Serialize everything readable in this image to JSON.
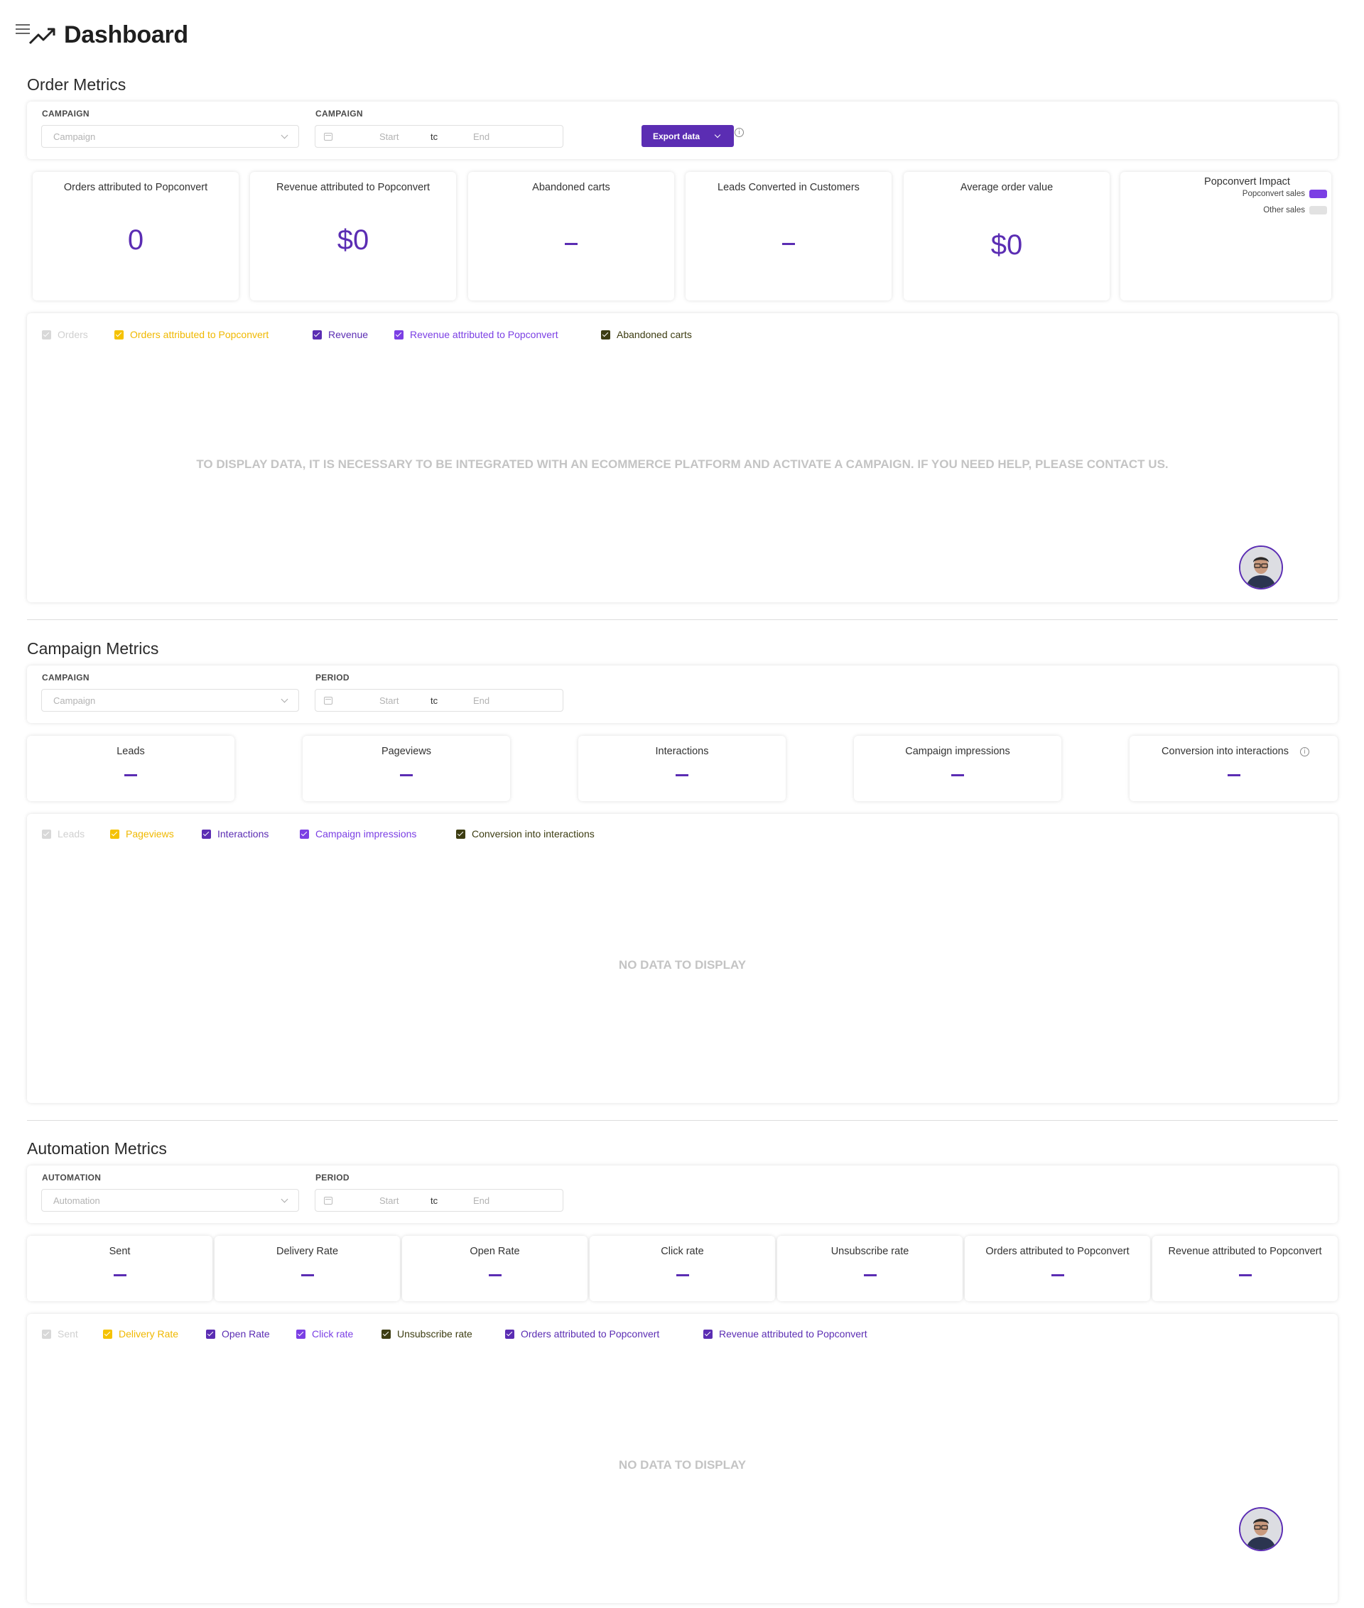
{
  "header": {
    "title": "Dashboard"
  },
  "order_metrics": {
    "title": "Order Metrics",
    "campaign_label": "CAMPAIGN",
    "campaign_placeholder": "Campaign",
    "period_label": "CAMPAIGN",
    "date_start": "Start",
    "date_sep": "tc",
    "date_end": "End",
    "export_label": "Export data",
    "cards": [
      {
        "title": "Orders attributed to Popconvert",
        "value": "0"
      },
      {
        "title": "Revenue attributed to Popconvert",
        "value": "$0"
      },
      {
        "title": "Abandoned carts",
        "value": ""
      },
      {
        "title": "Leads Converted in Customers",
        "value": ""
      },
      {
        "title": "Average order value",
        "value": "$0"
      },
      {
        "title": "Popconvert Impact",
        "value": ""
      }
    ],
    "impact_legend": [
      {
        "label": "Popconvert sales",
        "color": "#7b3fe4"
      },
      {
        "label": "Other sales",
        "color": "#e2e2e2"
      }
    ],
    "legend": [
      {
        "label": "Orders",
        "color": "#d8d8d8"
      },
      {
        "label": "Orders attributed to Popconvert",
        "color": "#f5c200"
      },
      {
        "label": "Revenue",
        "color": "#5b2db3"
      },
      {
        "label": "Revenue attributed to Popconvert",
        "color": "#7b3fe4"
      },
      {
        "label": "Abandoned carts",
        "color": "#3d3d12"
      }
    ],
    "empty_message": "TO DISPLAY DATA, IT IS NECESSARY TO BE INTEGRATED WITH AN ECOMMERCE PLATFORM AND ACTIVATE A CAMPAIGN. IF YOU NEED HELP, PLEASE CONTACT US."
  },
  "campaign_metrics": {
    "title": "Campaign Metrics",
    "campaign_label": "CAMPAIGN",
    "campaign_placeholder": "Campaign",
    "period_label": "PERIOD",
    "date_start": "Start",
    "date_sep": "tc",
    "date_end": "End",
    "cards": [
      {
        "title": "Leads"
      },
      {
        "title": "Pageviews"
      },
      {
        "title": "Interactions"
      },
      {
        "title": "Campaign impressions"
      },
      {
        "title": "Conversion into interactions"
      }
    ],
    "legend": [
      {
        "label": "Leads",
        "color": "#d8d8d8"
      },
      {
        "label": "Pageviews",
        "color": "#f5c200"
      },
      {
        "label": "Interactions",
        "color": "#5b2db3"
      },
      {
        "label": "Campaign impressions",
        "color": "#7b3fe4"
      },
      {
        "label": "Conversion into interactions",
        "color": "#3d3d12"
      }
    ],
    "empty_message": "NO DATA TO DISPLAY"
  },
  "automation_metrics": {
    "title": "Automation Metrics",
    "automation_label": "AUTOMATION",
    "automation_placeholder": "Automation",
    "period_label": "PERIOD",
    "date_start": "Start",
    "date_sep": "tc",
    "date_end": "End",
    "cards": [
      {
        "title": "Sent"
      },
      {
        "title": "Delivery Rate"
      },
      {
        "title": "Open Rate"
      },
      {
        "title": "Click rate"
      },
      {
        "title": "Unsubscribe rate"
      },
      {
        "title": "Orders attributed to Popconvert"
      },
      {
        "title": "Revenue attributed to Popconvert"
      }
    ],
    "legend": [
      {
        "label": "Sent",
        "color": "#d8d8d8"
      },
      {
        "label": "Delivery Rate",
        "color": "#f5c200"
      },
      {
        "label": "Open Rate",
        "color": "#5b2db3"
      },
      {
        "label": "Click rate",
        "color": "#7b3fe4"
      },
      {
        "label": "Unsubscribe rate",
        "color": "#3d3d12"
      },
      {
        "label": "Orders attributed to Popconvert",
        "color": "#5b2db3"
      },
      {
        "label": "Revenue attributed to Popconvert",
        "color": "#5b2db3"
      }
    ],
    "empty_message": "NO DATA TO DISPLAY"
  }
}
